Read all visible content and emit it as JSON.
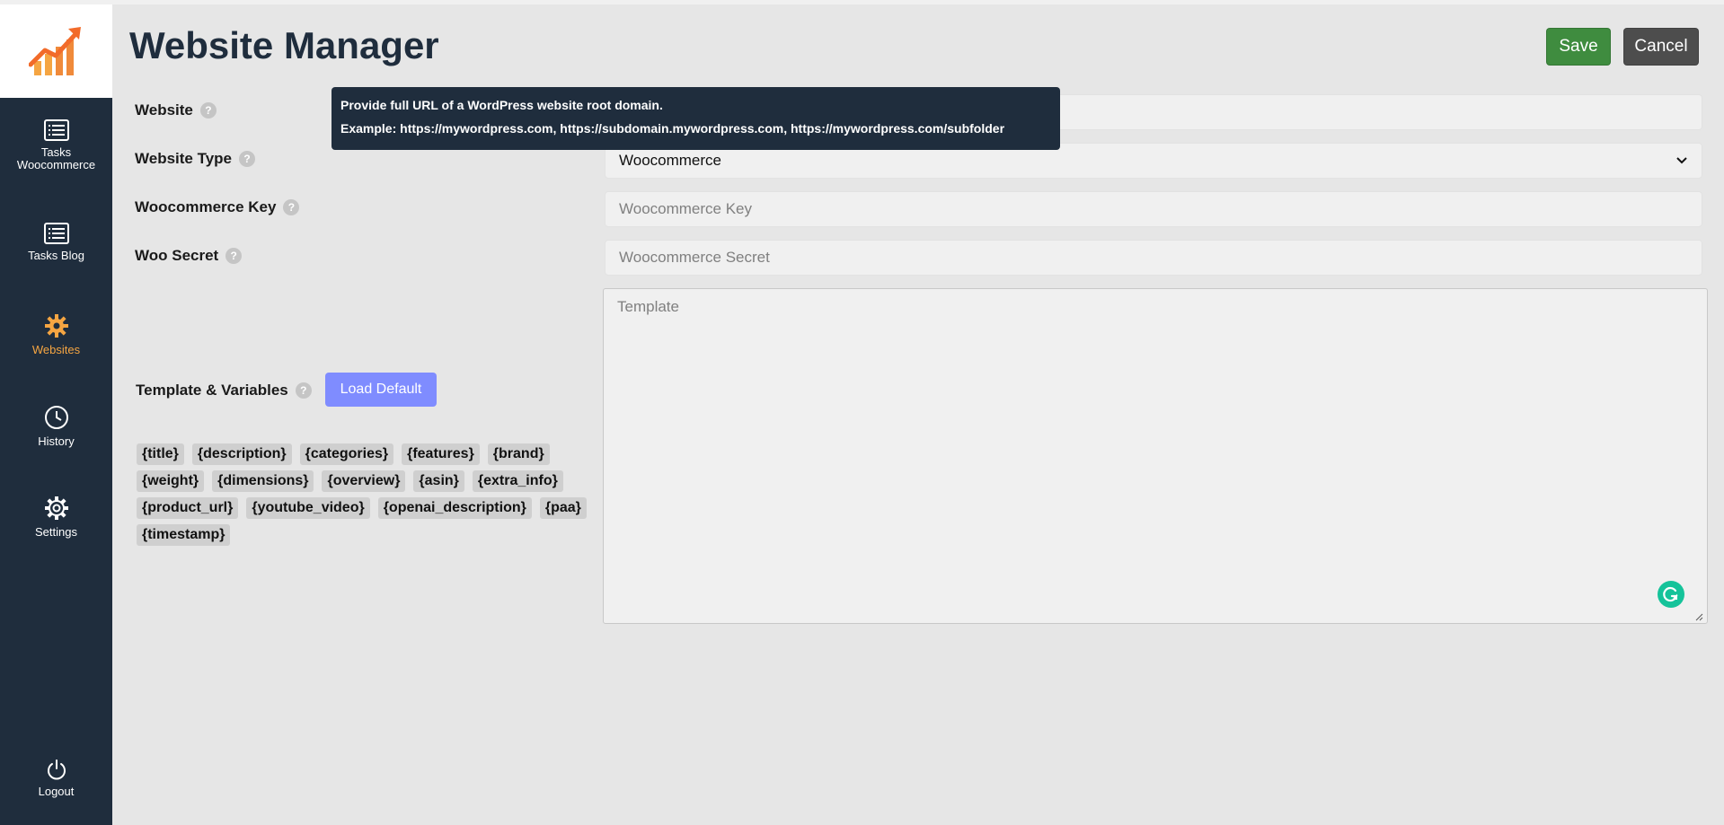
{
  "header": {
    "title": "Website Manager",
    "save_label": "Save",
    "cancel_label": "Cancel"
  },
  "sidebar": {
    "items": [
      {
        "label_line1": "Tasks",
        "label_line2": "Woocommerce",
        "icon": "list-icon"
      },
      {
        "label": "Tasks Blog",
        "icon": "list-icon"
      },
      {
        "label": "Websites",
        "icon": "gear-icon",
        "active": true
      },
      {
        "label": "History",
        "icon": "clock-icon"
      },
      {
        "label": "Settings",
        "icon": "gear-outline-icon"
      }
    ],
    "logout_label": "Logout"
  },
  "form": {
    "website_label": "Website",
    "website_type_label": "Website Type",
    "website_type_value": "Woocommerce",
    "woo_key_label": "Woocommerce Key",
    "woo_key_placeholder": "Woocommerce Key",
    "woo_secret_label": "Woo Secret",
    "woo_secret_placeholder": "Woocommerce Secret",
    "template_label": "Template & Variables",
    "template_placeholder": "Template",
    "load_default_label": "Load Default",
    "help_glyph": "?"
  },
  "variables": [
    "{title}",
    "{description}",
    "{categories}",
    "{features}",
    "{brand}",
    "{weight}",
    "{dimensions}",
    "{overview}",
    "{asin}",
    "{extra_info}",
    "{product_url}",
    "{youtube_video}",
    "{openai_description}",
    "{paa}",
    "{timestamp}"
  ],
  "tooltip": {
    "line1": "Provide full URL of a WordPress website root domain.",
    "line2": "Example: https://mywordpress.com, https://subdomain.mywordpress.com, https://mywordpress.com/subfolder"
  },
  "colors": {
    "sidebar_bg": "#1f2d3d",
    "accent": "#f5a542",
    "save_green": "#3f8c3f",
    "load_default": "#7f8cff"
  }
}
